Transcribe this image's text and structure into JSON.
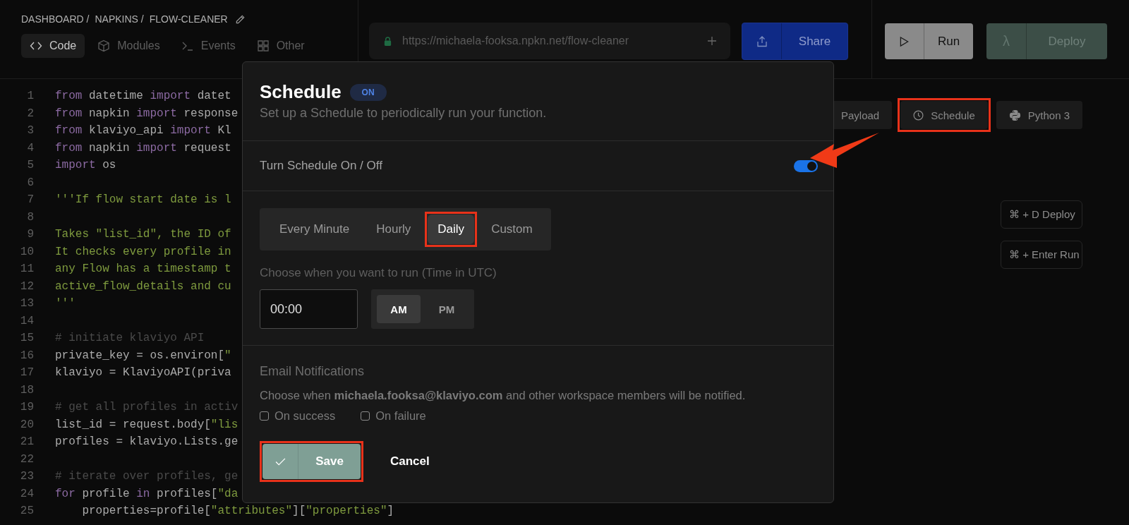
{
  "breadcrumb": [
    {
      "label": "DASHBOARD /",
      "editable": false
    },
    {
      "label": "NAPKINS /",
      "editable": false
    },
    {
      "label": "FLOW-CLEANER",
      "editable": true
    }
  ],
  "nav_tabs": [
    {
      "label": "Code",
      "kind": "code",
      "selected": true
    },
    {
      "label": "Modules",
      "kind": "cube",
      "selected": false
    },
    {
      "label": "Events",
      "kind": "terminal",
      "selected": false
    },
    {
      "label": "Other",
      "kind": "grid",
      "selected": false
    }
  ],
  "url_field": {
    "value": "https://michaela-fooksa.npkn.net/flow-cleaner"
  },
  "share_button": {
    "label": "Share"
  },
  "run_button": {
    "label": "Run"
  },
  "deploy_button": {
    "symbol": "λ",
    "label": "Deploy"
  },
  "editor": {
    "lines": [
      {
        "number": "1",
        "tokens": [
          {
            "kind": "kw",
            "text": "from"
          },
          {
            "kind": "pl",
            "text": " datetime "
          },
          {
            "kind": "kw",
            "text": "import"
          },
          {
            "kind": "pl",
            "text": " datet"
          }
        ]
      },
      {
        "number": "2",
        "tokens": [
          {
            "kind": "kw",
            "text": "from"
          },
          {
            "kind": "pl",
            "text": " napkin "
          },
          {
            "kind": "kw",
            "text": "import"
          },
          {
            "kind": "pl",
            "text": " response"
          }
        ]
      },
      {
        "number": "3",
        "tokens": [
          {
            "kind": "kw",
            "text": "from"
          },
          {
            "kind": "pl",
            "text": " klaviyo_api "
          },
          {
            "kind": "kw",
            "text": "import"
          },
          {
            "kind": "pl",
            "text": " Kl"
          }
        ]
      },
      {
        "number": "4",
        "tokens": [
          {
            "kind": "kw",
            "text": "from"
          },
          {
            "kind": "pl",
            "text": " napkin "
          },
          {
            "kind": "kw",
            "text": "import"
          },
          {
            "kind": "pl",
            "text": " request"
          }
        ]
      },
      {
        "number": "5",
        "tokens": [
          {
            "kind": "kw",
            "text": "import"
          },
          {
            "kind": "pl",
            "text": " os"
          }
        ]
      },
      {
        "number": "6"
      },
      {
        "number": "7",
        "tokens": [
          {
            "kind": "str",
            "text": "'''If flow start date is l"
          }
        ]
      },
      {
        "number": "8"
      },
      {
        "number": "9",
        "tokens": [
          {
            "kind": "str",
            "text": "Takes \"list_id\", the ID of"
          }
        ]
      },
      {
        "number": "10",
        "tokens": [
          {
            "kind": "str",
            "text": "It checks every profile in"
          }
        ]
      },
      {
        "number": "11",
        "tokens": [
          {
            "kind": "str",
            "text": "any Flow has a timestamp t"
          }
        ]
      },
      {
        "number": "12",
        "tokens": [
          {
            "kind": "str",
            "text": "active_flow_details and cu"
          }
        ]
      },
      {
        "number": "13",
        "tokens": [
          {
            "kind": "str",
            "text": "'''"
          }
        ]
      },
      {
        "number": "14"
      },
      {
        "number": "15",
        "tokens": [
          {
            "kind": "cm",
            "text": "# initiate klaviyo API"
          }
        ]
      },
      {
        "number": "16",
        "tokens": [
          {
            "kind": "pl",
            "text": "private_key = os.environ["
          },
          {
            "kind": "str",
            "text": "\""
          }
        ]
      },
      {
        "number": "17",
        "tokens": [
          {
            "kind": "pl",
            "text": "klaviyo = KlaviyoAPI(priva"
          }
        ]
      },
      {
        "number": "18"
      },
      {
        "number": "19",
        "tokens": [
          {
            "kind": "cm",
            "text": "# get all profiles in activ"
          }
        ]
      },
      {
        "number": "20",
        "tokens": [
          {
            "kind": "pl",
            "text": "list_id = request.body["
          },
          {
            "kind": "str",
            "text": "\"lis"
          }
        ]
      },
      {
        "number": "21",
        "tokens": [
          {
            "kind": "pl",
            "text": "profiles = klaviyo.Lists.ge"
          }
        ]
      },
      {
        "number": "22"
      },
      {
        "number": "23",
        "tokens": [
          {
            "kind": "cm",
            "text": "# iterate over profiles, ge"
          }
        ]
      },
      {
        "number": "24",
        "tokens": [
          {
            "kind": "kw",
            "text": "for"
          },
          {
            "kind": "pl",
            "text": " profile "
          },
          {
            "kind": "kw",
            "text": "in"
          },
          {
            "kind": "pl",
            "text": " profiles["
          },
          {
            "kind": "str",
            "text": "\"da"
          }
        ]
      },
      {
        "number": "25",
        "tokens": [
          {
            "kind": "pl",
            "text": "    properties=profile["
          },
          {
            "kind": "str",
            "text": "\"attributes\""
          },
          {
            "kind": "pl",
            "text": "]["
          },
          {
            "kind": "str",
            "text": "\"properties\""
          },
          {
            "kind": "pl",
            "text": "]"
          }
        ]
      }
    ]
  },
  "tool_buttons": [
    {
      "label": "Payload",
      "highlighted": false
    },
    {
      "label": "Schedule",
      "kind": "clock",
      "highlighted": true
    },
    {
      "label": "Python 3",
      "kind": "python",
      "highlighted": false
    }
  ],
  "shortcuts": [
    {
      "label": "⌘ + D Deploy"
    },
    {
      "label": "⌘ + Enter Run"
    }
  ],
  "modal": {
    "title": "Schedule",
    "badge": "ON",
    "subtitle": "Set up a Schedule to periodically run your function.",
    "toggle": {
      "label": "Turn Schedule On / Off",
      "on": true
    },
    "frequency_options": [
      {
        "label": "Every Minute",
        "selected": false,
        "highlighted": false
      },
      {
        "label": "Hourly",
        "selected": false,
        "highlighted": false
      },
      {
        "label": "Daily",
        "selected": true,
        "highlighted": true
      },
      {
        "label": "Custom",
        "selected": false,
        "highlighted": false
      }
    ],
    "time_label": "Choose when you want to run (Time in UTC)",
    "time": {
      "value": "00:00"
    },
    "meridiem": [
      {
        "label": "AM",
        "selected": true
      },
      {
        "label": "PM",
        "selected": false
      }
    ],
    "email": {
      "heading": "Email Notifications",
      "text": "Choose when **michaela.fooksa@klaviyo.com** and other workspace members will be notified.",
      "options": [
        {
          "label": "On success",
          "checked": false
        },
        {
          "label": "On failure",
          "checked": false
        }
      ]
    },
    "save_button": {
      "label": "Save",
      "highlighted": true
    },
    "cancel_button": {
      "label": "Cancel"
    }
  }
}
